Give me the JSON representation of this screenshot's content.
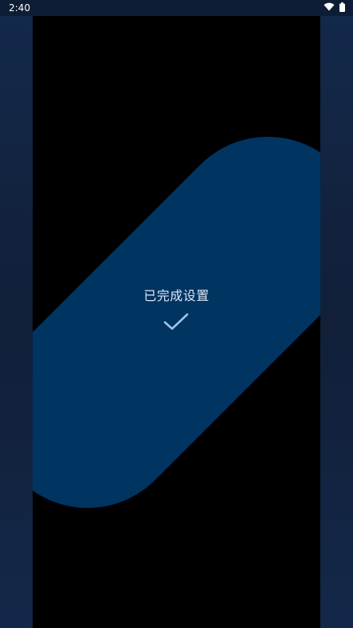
{
  "status_bar": {
    "time": "2:40",
    "icons": [
      "wifi-icon",
      "battery-icon"
    ]
  },
  "setup": {
    "done_label": "已完成设置",
    "check_icon": "checkmark-icon"
  },
  "colors": {
    "pill": "#003461",
    "background": "#000000",
    "side_panels": "#112240",
    "text": "#dce6f4",
    "check": "#9ec2ec"
  }
}
